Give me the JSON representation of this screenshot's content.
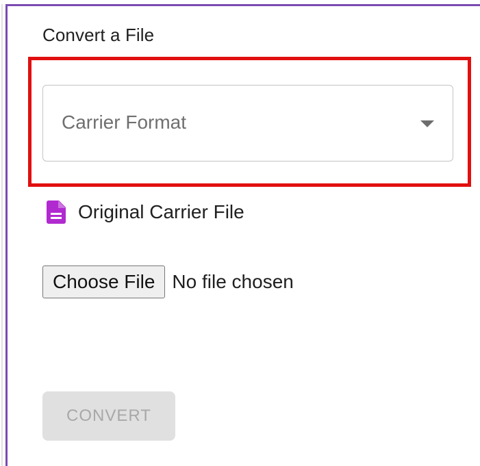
{
  "card": {
    "title": "Convert a File"
  },
  "format_select": {
    "placeholder": "Carrier Format",
    "icon": "chevron-down-icon",
    "highlight_color": "#e10f0f"
  },
  "file_section": {
    "icon": "document-icon",
    "icon_color": "#b12ad0",
    "label": "Original Carrier File",
    "choose_button_label": "Choose File",
    "status": "No file chosen"
  },
  "actions": {
    "convert_label": "CONVERT",
    "convert_disabled": true
  },
  "colors": {
    "accent_border": "#7a4ab3",
    "disabled_button_bg": "#e0e0e0",
    "disabled_button_text": "#a8a8a8"
  }
}
